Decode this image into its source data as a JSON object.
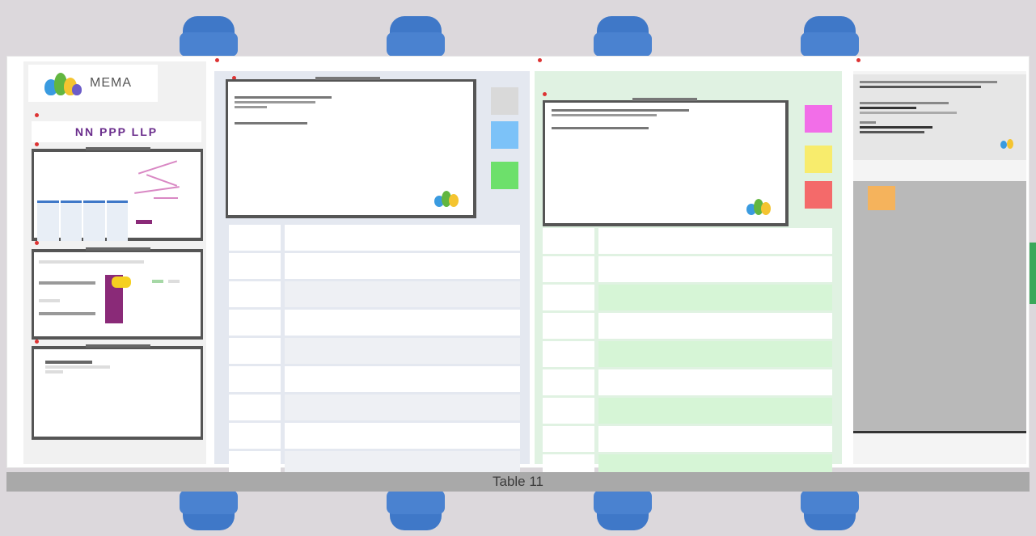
{
  "table": {
    "label": "Table 11"
  },
  "left_panel": {
    "logo_text": "MEMA",
    "banner_text": "NN PPP LLP"
  },
  "colors": {
    "chair": "#3f78c8",
    "board_bg": "#dcd8dc",
    "note_gray": "#d9d9d9",
    "note_blue": "#7cc2f8",
    "note_green": "#6de06b",
    "note_magenta": "#f26ee8",
    "note_yellow": "#f8ec6c",
    "note_red": "#f46a6a",
    "note_orange": "#f5b35c"
  },
  "icons": [
    "chair-icon",
    "pin-icon",
    "sticky-note-icon",
    "logo-icon"
  ]
}
